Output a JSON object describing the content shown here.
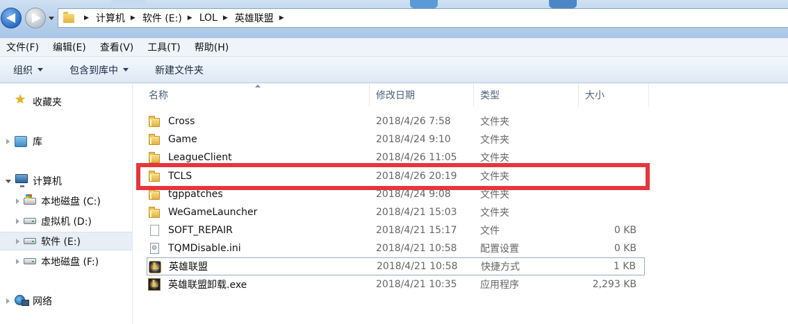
{
  "address_bar": {
    "breadcrumbs": [
      "计算机",
      "软件 (E:)",
      "LOL",
      "英雄联盟"
    ]
  },
  "menu": {
    "items": [
      "文件(F)",
      "编辑(E)",
      "查看(V)",
      "工具(T)",
      "帮助(H)"
    ]
  },
  "toolbar": {
    "organize_label": "组织",
    "include_label": "包含到库中",
    "new_folder_label": "新建文件夹"
  },
  "sidebar": {
    "favorites": "收藏夹",
    "libraries": "库",
    "computer": "计算机",
    "drives": [
      {
        "label": "本地磁盘 (C:)",
        "icon": "system-drive-icon"
      },
      {
        "label": "虚拟机 (D:)",
        "icon": "drive-icon"
      },
      {
        "label": "软件 (E:)",
        "icon": "drive-icon",
        "selected": true
      },
      {
        "label": "本地磁盘 (F:)",
        "icon": "drive-icon"
      }
    ],
    "network": "网络"
  },
  "columns": {
    "name": "名称",
    "date": "修改日期",
    "type": "类型",
    "size": "大小"
  },
  "files": [
    {
      "name": "Cross",
      "date": "2018/4/26 7:58",
      "type": "文件夹",
      "size": "",
      "icon": "folder-icon"
    },
    {
      "name": "Game",
      "date": "2018/4/24 9:10",
      "type": "文件夹",
      "size": "",
      "icon": "folder-icon"
    },
    {
      "name": "LeagueClient",
      "date": "2018/4/26 11:05",
      "type": "文件夹",
      "size": "",
      "icon": "folder-icon"
    },
    {
      "name": "TCLS",
      "date": "2018/4/26 20:19",
      "type": "文件夹",
      "size": "",
      "icon": "folder-icon"
    },
    {
      "name": "tgppatches",
      "date": "2018/4/24 9:08",
      "type": "文件夹",
      "size": "",
      "icon": "folder-icon"
    },
    {
      "name": "WeGameLauncher",
      "date": "2018/4/21 15:03",
      "type": "文件夹",
      "size": "",
      "icon": "folder-icon"
    },
    {
      "name": "SOFT_REPAIR",
      "date": "2018/4/21 15:17",
      "type": "文件",
      "size": "0 KB",
      "icon": "file-icon"
    },
    {
      "name": "TQMDisable.ini",
      "date": "2018/4/21 10:58",
      "type": "配置设置",
      "size": "0 KB",
      "icon": "ini-file-icon"
    },
    {
      "name": "英雄联盟",
      "date": "2018/4/21 10:58",
      "type": "快捷方式",
      "size": "1 KB",
      "icon": "lol-shortcut-icon"
    },
    {
      "name": "英雄联盟卸载.exe",
      "date": "2018/4/21 10:35",
      "type": "应用程序",
      "size": "2,293 KB",
      "icon": "lol-exe-icon"
    }
  ],
  "colors": {
    "highlight": "#e6363c",
    "folder": "#e2b33d",
    "address_bar": "#b9d2ec"
  }
}
